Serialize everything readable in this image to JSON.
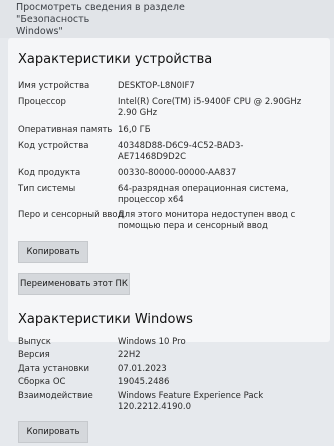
{
  "top": {
    "link_line1": "Просмотреть сведения в разделе \"Безопасность",
    "link_line2": "Windows\""
  },
  "device": {
    "title": "Характеристики устройства",
    "rows": [
      {
        "label": "Имя устройства",
        "value": "DESKTOP-L8N0IF7"
      },
      {
        "label": "Процессор",
        "value": "Intel(R) Core(TM) i5-9400F CPU @ 2.90GHz 2.90 GHz"
      },
      {
        "label": "Оперативная память",
        "value": "16,0 ГБ"
      },
      {
        "label": "Код устройства",
        "value": "40348D88-D6C9-4C52-BAD3-AE71468D9D2C"
      },
      {
        "label": "Код продукта",
        "value": "00330-80000-00000-AA837"
      },
      {
        "label": "Тип системы",
        "value": "64-разрядная операционная система, процессор x64"
      },
      {
        "label": "Перо и сенсорный ввод",
        "value": "Для этого монитора недоступен ввод с помощью пера и сенсорный ввод"
      }
    ],
    "copy_button": "Копировать",
    "rename_button": "Переименовать этот ПК"
  },
  "windows": {
    "title": "Характеристики Windows",
    "rows": [
      {
        "label": "Выпуск",
        "value": "Windows 10 Pro"
      },
      {
        "label": "Версия",
        "value": "22H2"
      },
      {
        "label": "Дата установки",
        "value": "07.01.2023"
      },
      {
        "label": "Сборка ОС",
        "value": "19045.2486"
      },
      {
        "label": "Взаимодействие",
        "value": "Windows Feature Experience Pack 120.2212.4190.0"
      }
    ],
    "copy_button": "Копировать"
  }
}
